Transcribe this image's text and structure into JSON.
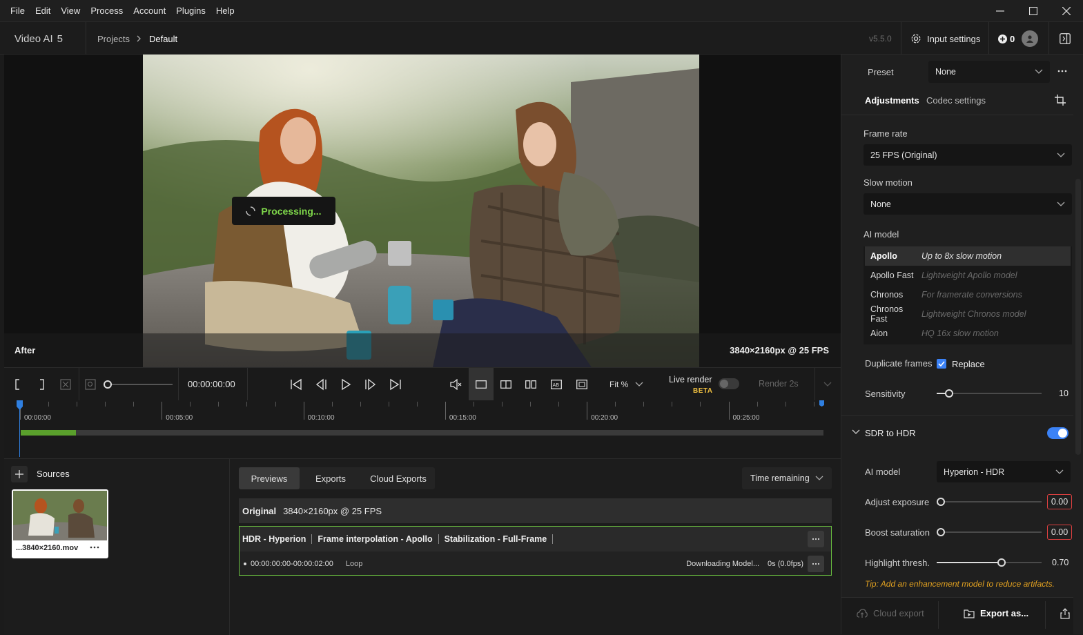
{
  "menu": {
    "items": [
      "File",
      "Edit",
      "View",
      "Process",
      "Account",
      "Plugins",
      "Help"
    ]
  },
  "header": {
    "app_name": "Video AI",
    "app_version_num": "5",
    "breadcrumb_projects": "Projects",
    "breadcrumb_current": "Default",
    "version": "v5.5.0",
    "input_settings": "Input settings",
    "credits": "0"
  },
  "viewer": {
    "processing": "Processing...",
    "after_label": "After",
    "resolution": "3840×2160px @ 25 FPS"
  },
  "controls": {
    "timecode": "00:00:00:00",
    "fit_label": "Fit %",
    "live_render": "Live render",
    "beta": "BETA",
    "render_label": "Render 2s"
  },
  "timeline": {
    "labels": [
      "00:00:00",
      "00:05:00",
      "00:10:00",
      "00:15:00",
      "00:20:00",
      "00:25:00"
    ],
    "progress": 0.069
  },
  "sources": {
    "title": "Sources",
    "item_name": "...3840×2160.mov"
  },
  "previews": {
    "tabs": [
      "Previews",
      "Exports",
      "Cloud Exports"
    ],
    "sort_label": "Time remaining",
    "original_label": "Original",
    "original_res": "3840×2160px @ 25 FPS",
    "job_parts": [
      "HDR - Hyperion",
      "Frame interpolation -  Apollo",
      "Stabilization -  Full-Frame"
    ],
    "job_range": "00:00:00:00-00:00:02:00",
    "job_loop": "Loop",
    "job_status": "Downloading Model...",
    "job_speed": "0s (0.0fps)"
  },
  "panel": {
    "preset_label": "Preset",
    "preset_value": "None",
    "tab_adjustments": "Adjustments",
    "tab_codec": "Codec settings",
    "frame_rate_label": "Frame rate",
    "frame_rate_value": "25 FPS (Original)",
    "slow_motion_label": "Slow motion",
    "slow_motion_value": "None",
    "ai_model_label": "AI model",
    "models": [
      {
        "name": "Apollo",
        "desc": "Up to 8x slow motion"
      },
      {
        "name": "Apollo Fast",
        "desc": "Lightweight Apollo model"
      },
      {
        "name": "Chronos",
        "desc": "For framerate conversions"
      },
      {
        "name": "Chronos Fast",
        "desc": "Lightweight Chronos model"
      },
      {
        "name": "Aion",
        "desc": "HQ 16x slow motion"
      }
    ],
    "duplicate_frames_label": "Duplicate frames",
    "replace_label": "Replace",
    "sensitivity_label": "Sensitivity",
    "sensitivity_value": "10",
    "sdr_hdr_label": "SDR to HDR",
    "hdr_model_label": "AI model",
    "hdr_model_value": "Hyperion - HDR",
    "adjust_exposure_label": "Adjust exposure",
    "adjust_exposure_value": "0.00",
    "boost_saturation_label": "Boost saturation",
    "boost_saturation_value": "0.00",
    "highlight_label": "Highlight thresh.",
    "highlight_value": "0.70",
    "tip": "Tip: Add an enhancement model to reduce artifacts.",
    "cloud_export": "Cloud export",
    "export_as": "Export as..."
  },
  "colors": {
    "accent": "#3b82f6",
    "green": "#7fd84a",
    "beta": "#f0c040",
    "warn": "#e04040"
  }
}
